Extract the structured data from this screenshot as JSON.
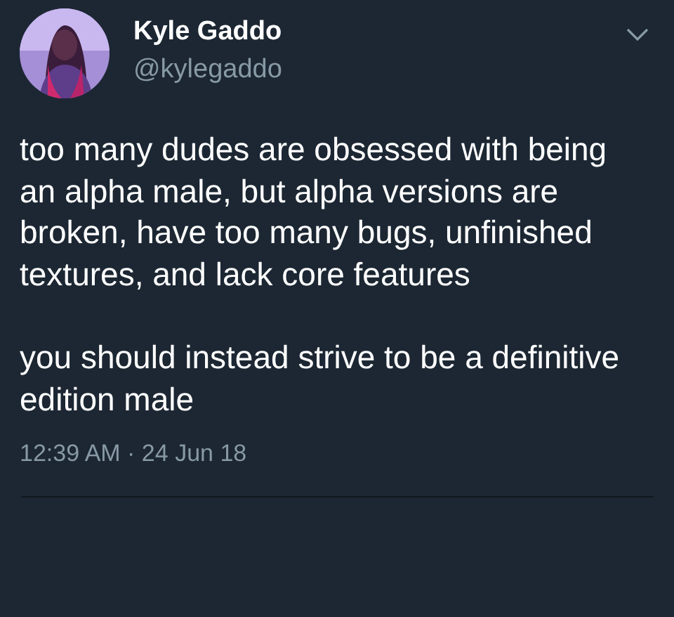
{
  "tweet": {
    "author": {
      "name": "Kyle Gaddo",
      "handle": "@kylegaddo"
    },
    "paragraphs": [
      "too many dudes are obsessed with being an alpha male, but alpha versions are broken, have too many bugs, unfinished textures, and lack core features",
      "you should instead strive to be a definitive edition male"
    ],
    "timestamp": "12:39 AM · 24 Jun 18"
  }
}
